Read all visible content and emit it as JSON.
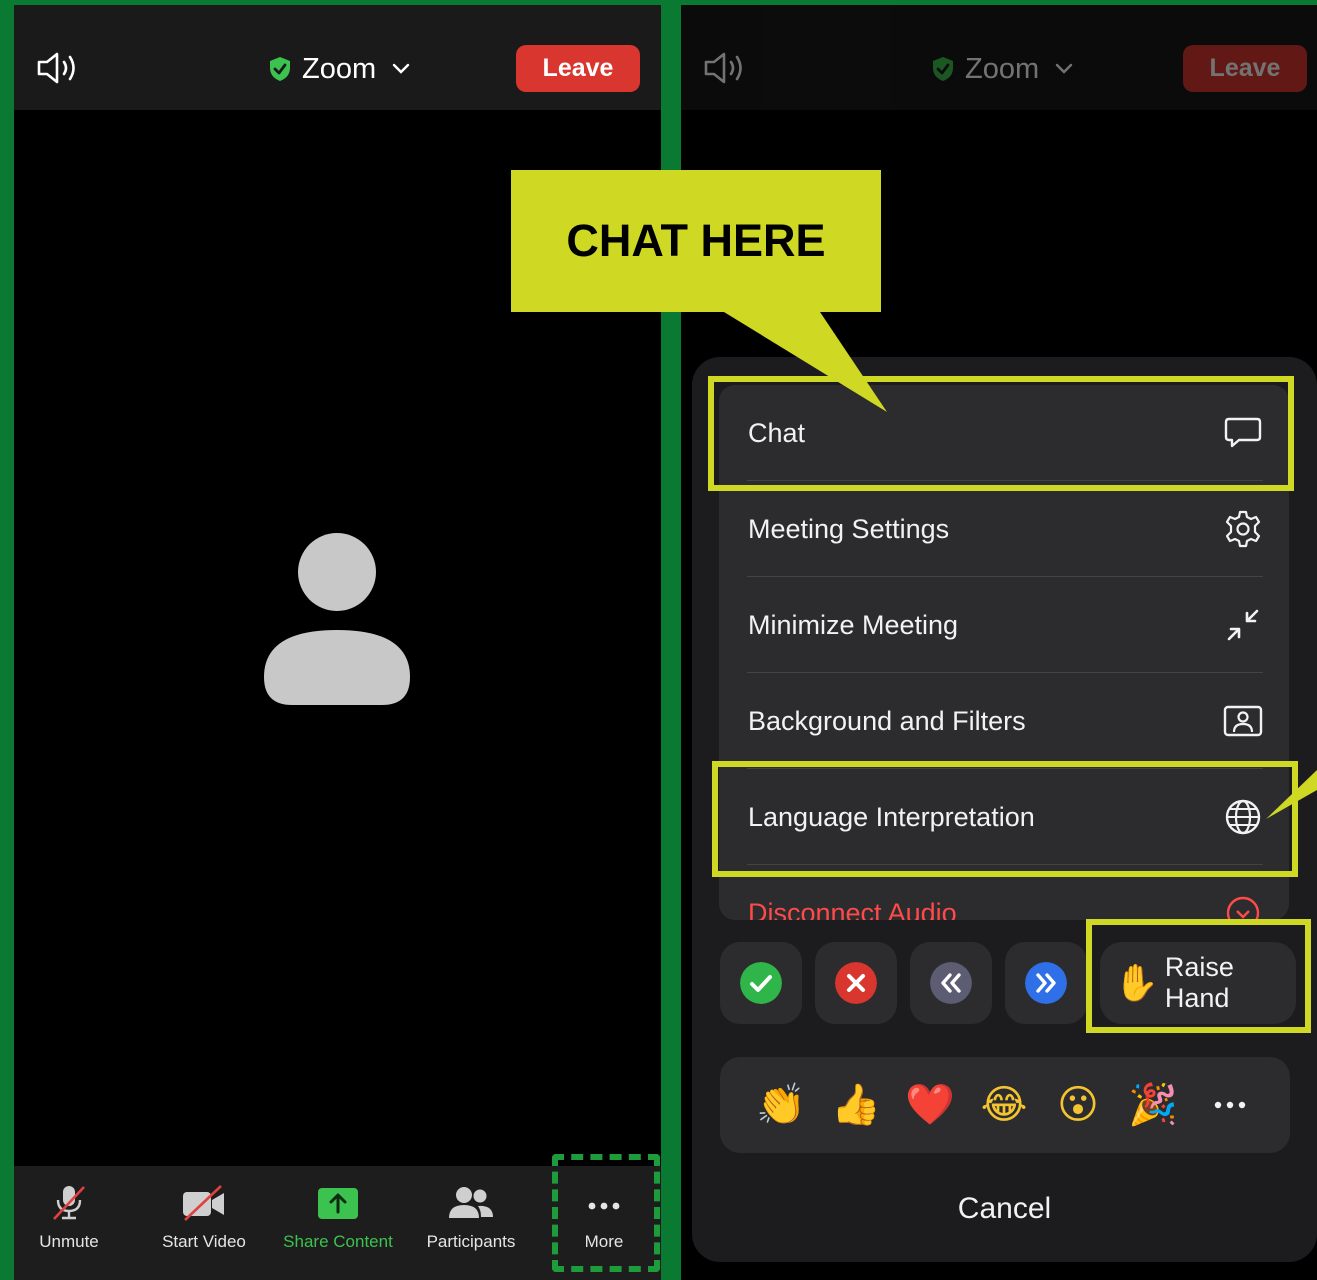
{
  "left_panel": {
    "header": {
      "title": "Zoom",
      "leave_label": "Leave"
    },
    "toolbar": {
      "items": [
        {
          "label": "Unmute",
          "icon": "microphone-muted-icon"
        },
        {
          "label": "Start Video",
          "icon": "video-off-icon"
        },
        {
          "label": "Share Content",
          "icon": "share-upload-icon"
        },
        {
          "label": "Participants",
          "icon": "participants-icon"
        },
        {
          "label": "More",
          "icon": "ellipsis-icon"
        }
      ]
    }
  },
  "right_panel": {
    "header": {
      "title": "Zoom",
      "leave_label": "Leave"
    },
    "menu": {
      "items": [
        {
          "label": "Chat",
          "icon": "chat-bubble-icon"
        },
        {
          "label": "Meeting Settings",
          "icon": "gear-icon"
        },
        {
          "label": "Minimize Meeting",
          "icon": "minimize-arrows-icon"
        },
        {
          "label": "Background and Filters",
          "icon": "background-portrait-icon"
        },
        {
          "label": "Language Interpretation",
          "icon": "globe-icon"
        },
        {
          "label": "Disconnect Audio",
          "icon": "disconnect-audio-icon"
        }
      ]
    },
    "reactions": {
      "feedback": [
        {
          "name": "yes",
          "color": "#2fb54a",
          "icon": "check-icon"
        },
        {
          "name": "no",
          "color": "#d9362f",
          "icon": "x-icon"
        },
        {
          "name": "slower",
          "color": "#5c5c73",
          "icon": "rewind-icon"
        },
        {
          "name": "faster",
          "color": "#2f6fe8",
          "icon": "fast-forward-icon"
        }
      ],
      "raise_hand_label": "Raise Hand",
      "raise_hand_emoji": "✋",
      "emojis": [
        "👏",
        "👍",
        "❤️",
        "😂",
        "😮",
        "🎉"
      ]
    },
    "cancel_label": "Cancel"
  },
  "annotation": {
    "callout_text": "CHAT HERE",
    "highlight_color": "#cfd822",
    "dashed_color": "#1e9c3c"
  },
  "colors": {
    "frame": "#0a7a33",
    "leave": "#d9362f",
    "share_green": "#3cc24e",
    "shield_green": "#3cc24e"
  }
}
